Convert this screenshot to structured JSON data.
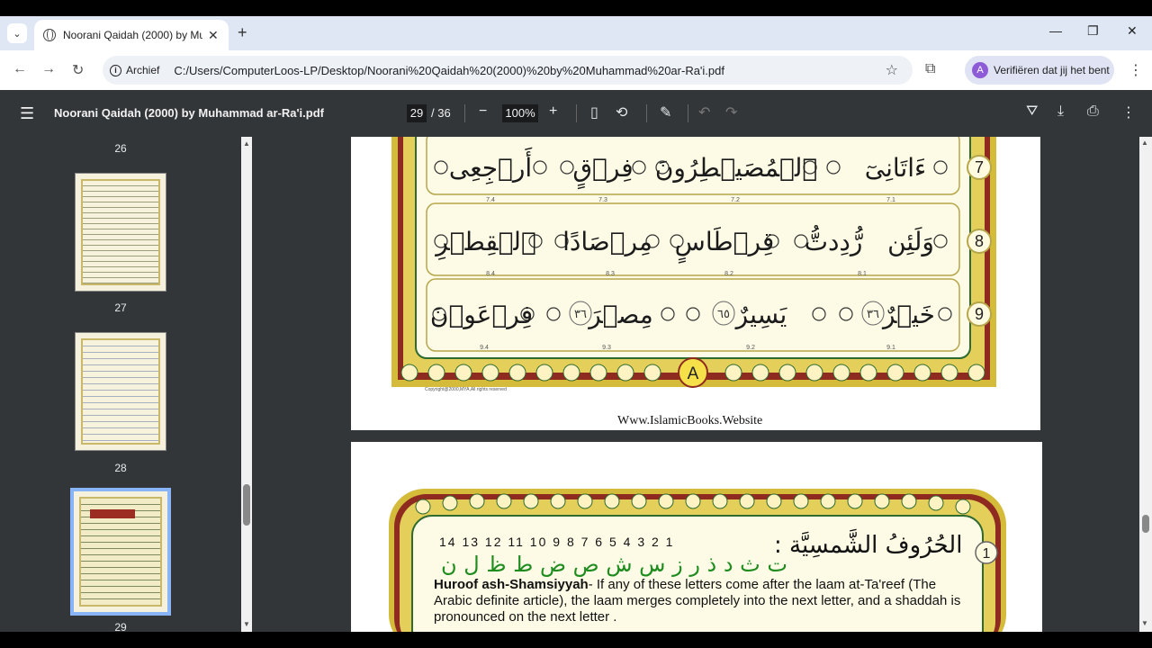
{
  "browser": {
    "tab_title": "Noorani Qaidah (2000) by Muh",
    "new_tab_symbol": "+",
    "security_chip": "Archief",
    "url": "C:/Users/ComputerLoos-LP/Desktop/Noorani%20Qaidah%20(2000)%20by%20Muhammad%20ar-Ra'i.pdf",
    "profile_button": "Verifiëren dat jij het bent",
    "profile_initial": "A"
  },
  "pdf_toolbar": {
    "document_title": "Noorani Qaidah (2000) by Muhammad ar-Ra'i.pdf",
    "current_page": "29",
    "total_pages": "/ 36",
    "zoom": "100%"
  },
  "thumbnails": [
    {
      "label": "26"
    },
    {
      "label": "27"
    },
    {
      "label": "28"
    },
    {
      "label": "29",
      "selected": true
    }
  ],
  "page_upper": {
    "rows": [
      {
        "number": "7",
        "words": [
          "ءَاتَانِىٓ",
          "ٱلۡمُصَيۡطِرُونَ",
          "فِرۡقٍ",
          "أَرۡجِعِى"
        ],
        "sub_labels": [
          "7.1",
          "7.2",
          "7.3",
          "7.4"
        ]
      },
      {
        "number": "8",
        "words": [
          "وَلَئِن",
          "رُّدِدتُّ",
          "قِرۡطَاسٍ",
          "مِرۡصَادًا",
          "ٱلۡقِطۡرِ"
        ],
        "sub_labels": [
          "8.1",
          "8.2",
          "8.3",
          "8.4"
        ]
      },
      {
        "number": "9",
        "words": [
          "خَيۡرٌ",
          "يَسِيرٌ",
          "مِصۡرَ",
          "فِرۡعَوۡنَ"
        ],
        "sub_labels": [
          "9.1",
          "9.2",
          "9.3",
          "9.4"
        ],
        "ayah_markers": [
          "٣٦",
          "٦٥",
          "٣٦"
        ]
      }
    ],
    "footer_badge": "A",
    "copyright": "Copyright@2000,MYA,All rights reserved",
    "website": "Www.IslamicBooks.Website"
  },
  "page_lower": {
    "section_number": "1",
    "letter_numbers": "14 13 12 11 10 9 8 7 6 5 4 3 2 1",
    "arabic_title": "الحُرُوفُ الشَّمسِيَّة :",
    "letters": "ت ث د ذ ر ز س ش ص ض ط ظ ل ن",
    "heading": "Huroof ash-Shamsiyyah",
    "body": "- If any of these letters come after the laam at-Ta'reef (The Arabic definite article), the laam merges completely into the next letter, and a shaddah is pronounced on the next letter ."
  },
  "colors": {
    "border_gold": "#d4bb3a",
    "border_red": "#8e2a1f",
    "frame_green": "#2f6b2f",
    "panel_cream": "#fdfbe6",
    "toolbar_dark": "#323639",
    "selection_blue": "#8ab4f8"
  }
}
